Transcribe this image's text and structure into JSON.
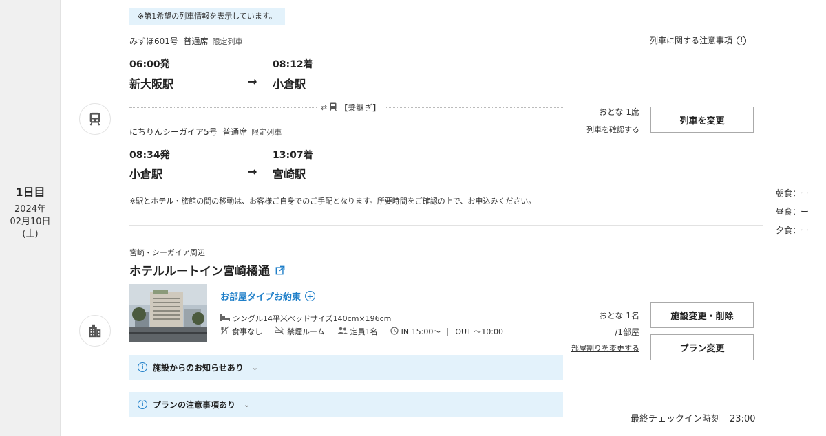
{
  "day": {
    "label": "1日目",
    "year": "2024年",
    "date": "02月10日",
    "weekday": "(土)"
  },
  "meals": {
    "breakfast": "朝食：ー",
    "lunch": "昼食：ー",
    "dinner": "夕食：ー"
  },
  "train": {
    "note": "※第1希望の列車情報を表示しています。",
    "caution_label": "列車に関する注意事項",
    "transfer_label": "【乗継ぎ】",
    "leg1": {
      "name": "みずほ601号",
      "seat": "普通席",
      "limited": "限定列車",
      "dep_time": "06:00発",
      "arr_time": "08:12着",
      "from": "新大阪駅",
      "to": "小倉駅"
    },
    "leg2": {
      "name": "にちりんシーガイア5号",
      "seat": "普通席",
      "limited": "限定列車",
      "dep_time": "08:34発",
      "arr_time": "13:07着",
      "from": "小倉駅",
      "to": "宮崎駅"
    },
    "arrow": "→",
    "passengers": "おとな 1席",
    "check_link": "列車を確認する",
    "change_button": "列車を変更",
    "footnote": "※駅とホテル・旅館の間の移動は、お客様ご自身でのご手配となります。所要時間をご確認の上で、お申込みください。"
  },
  "hotel": {
    "area": "宮崎・シーガイア周辺",
    "name": "ホテルルートイン宮崎橘通",
    "room_type_label": "お部屋タイプお約束",
    "room": "シングル14平米ベッドサイズ140cm×196cm",
    "meal": "食事なし",
    "smoking": "禁煙ルーム",
    "capacity": "定員1名",
    "checkin_out": "IN 15:00〜",
    "checkout": "OUT 〜10:00",
    "guests": "おとな 1名",
    "rooms": "/1部屋",
    "room_change_link": "部屋割りを変更する",
    "facility_button": "施設変更・削除",
    "plan_button": "プラン変更",
    "notice_facility": "施設からのお知らせあり",
    "notice_plan": "プランの注意事項あり",
    "last_checkin_label": "最終チェックイン時刻",
    "last_checkin_time": "23:00"
  }
}
